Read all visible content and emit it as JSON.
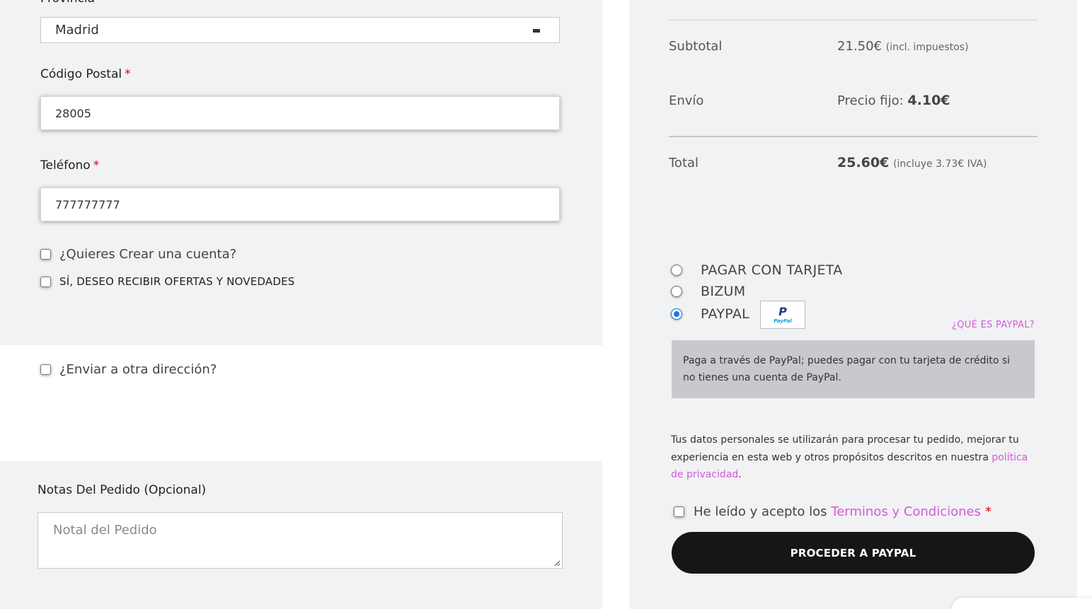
{
  "billing": {
    "province_label_cut": "Provincia",
    "province_value": "Madrid",
    "postal_label": "Código Postal",
    "postal_value": "28005",
    "phone_label": "Teléfono",
    "phone_value": "777777777",
    "required_mark": "*",
    "create_account_label": "¿Quieres Crear una cuenta?",
    "offers_label": "SÍ, DESEO RECIBIR OFERTAS Y NOVEDADES"
  },
  "shipping": {
    "other_address_label": "¿Enviar a otra dirección?"
  },
  "notes": {
    "label": "Notas Del Pedido (Opcional)",
    "placeholder": "Notal del Pedido"
  },
  "summary": {
    "subtotal_label": "Subtotal",
    "subtotal_value": "21.50€",
    "subtotal_note": "(incl. impuestos)",
    "shipping_label": "Envío",
    "shipping_prefix": "Precio fijo:",
    "shipping_value": "4.10€",
    "total_label": "Total",
    "total_value": "25.60€",
    "total_note": "(incluye 3.73€ IVA)"
  },
  "payment": {
    "options": [
      {
        "label": "PAGAR CON TARJETA",
        "selected": false
      },
      {
        "label": "BIZUM",
        "selected": false
      },
      {
        "label": "PAYPAL",
        "selected": true
      }
    ],
    "paypal_logo_mark": "P",
    "paypal_logo_word": "PayPal",
    "what_is_paypal": "¿QUÉ ES PAYPAL?",
    "paypal_info": "Paga a través de PayPal; puedes pagar con tu tarjeta de crédito si no tienes una cuenta de PayPal."
  },
  "privacy": {
    "text": "Tus datos personales se utilizarán para procesar tu pedido, mejorar tu experiencia en esta web y otros propósitos descritos en nuestra",
    "link": "política de privacidad",
    "end": "."
  },
  "terms": {
    "prefix": "He leído y acepto los",
    "link": "Terminos y Condiciones",
    "required_mark": "*"
  },
  "proceed_button": "PROCEDER A PAYPAL",
  "colors": {
    "accent_link": "#d35ad8",
    "required": "#e2001a",
    "button_bg": "#161616",
    "panel_bg": "#f1f2f4",
    "radio_selected": "#1a73e8"
  }
}
